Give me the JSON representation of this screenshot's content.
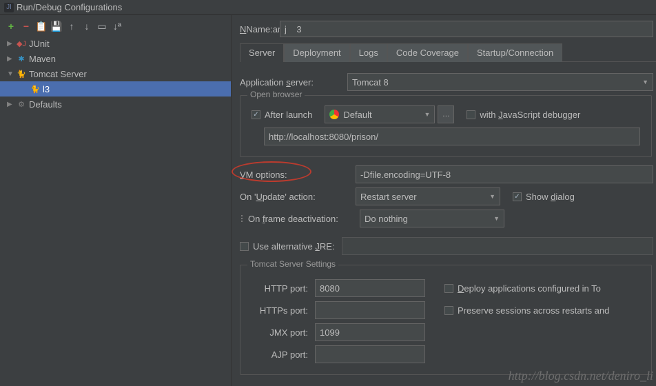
{
  "title": "Run/Debug Configurations",
  "tree": {
    "junit": "JUnit",
    "maven": "Maven",
    "tomcat": "Tomcat Server",
    "tomcat_child": "l3",
    "defaults": "Defaults"
  },
  "name_label": "Name:",
  "name_value": "j    3",
  "tabs": [
    "Server",
    "Deployment",
    "Logs",
    "Code Coverage",
    "Startup/Connection"
  ],
  "server": {
    "app_server_label": "Application server:",
    "app_server_value": "Tomcat 8",
    "open_browser_legend": "Open browser",
    "after_launch_label": "After launch",
    "browser_value": "Default",
    "with_js_label": "with JavaScript debugger",
    "url_value": "http://localhost:8080/prison/",
    "vm_label": "VM options:",
    "vm_value": "-Dfile.encoding=UTF-8",
    "update_label": "On 'Update' action:",
    "update_value": "Restart server",
    "show_dialog_label": "Show dialog",
    "frame_label": "On frame deactivation:",
    "frame_value": "Do nothing",
    "alt_jre_label": "Use alternative JRE:",
    "ts_legend": "Tomcat Server Settings",
    "http_label": "HTTP port:",
    "http_value": "8080",
    "https_label": "HTTPs port:",
    "https_value": "",
    "jmx_label": "JMX port:",
    "jmx_value": "1099",
    "ajp_label": "AJP port:",
    "ajp_value": "",
    "deploy_label": "Deploy applications configured in To",
    "preserve_label": "Preserve sessions across restarts and"
  },
  "watermark": "http://blog.csdn.net/deniro_li"
}
